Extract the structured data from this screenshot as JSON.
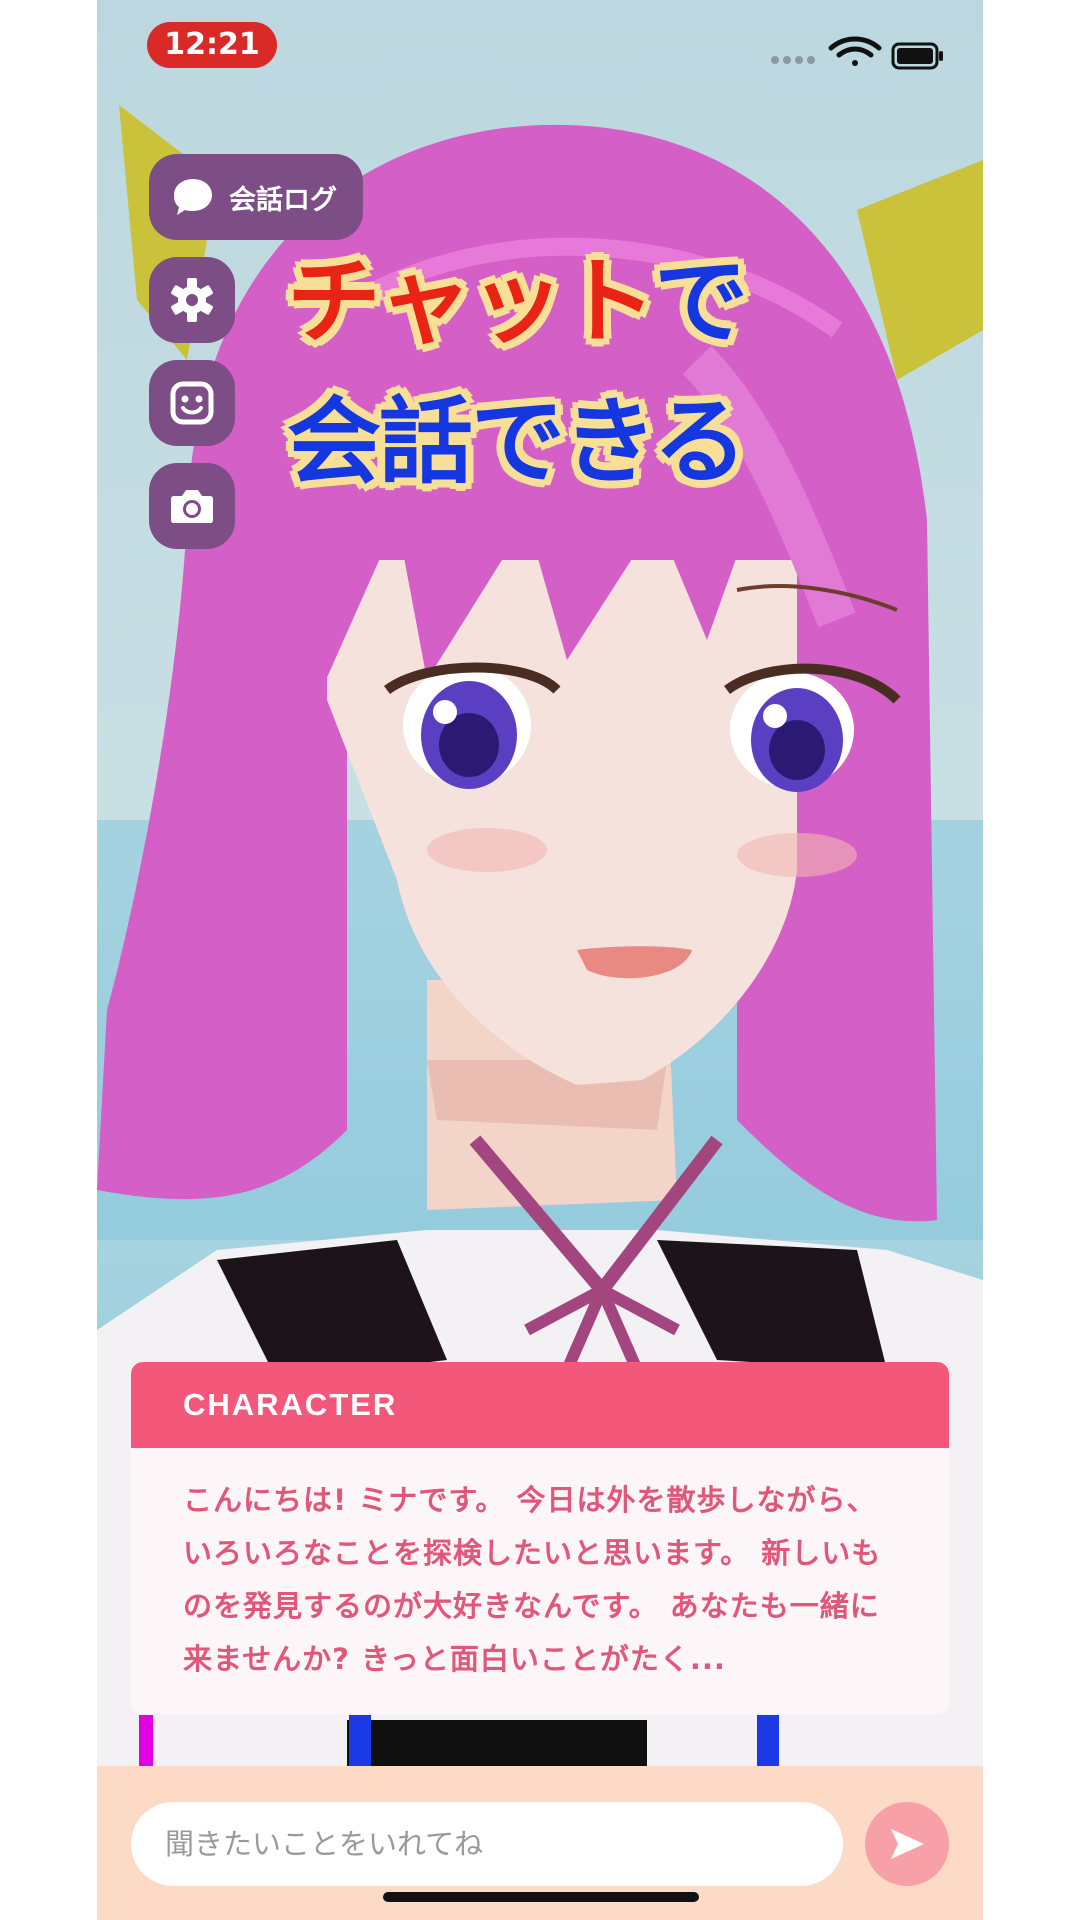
{
  "status_bar": {
    "time": "12:21",
    "icons": [
      "signal-icon",
      "wifi-icon",
      "battery-icon"
    ]
  },
  "side_menu": {
    "log_button_label": "会話ログ",
    "log_icon": "speech-bubble-icon",
    "buttons": [
      {
        "name": "settings-button",
        "icon": "gear-icon"
      },
      {
        "name": "expression-button",
        "icon": "smile-face-icon"
      },
      {
        "name": "camera-button",
        "icon": "camera-icon"
      }
    ]
  },
  "overlay_caption": {
    "line1_red": "チャット",
    "line1_blue": "で",
    "line2": "会話できる"
  },
  "character_card": {
    "header": "CHARACTER",
    "message": "こんにちは! ミナです。 今日は外を散歩しながら、いろいろなことを探検したいと思います。 新しいものを発見するのが大好きなんです。 あなたも一緒に来ませんか? きっと面白いことがたく..."
  },
  "input_bar": {
    "placeholder": "聞きたいことをいれてね",
    "value": "",
    "send_icon": "send-arrow-icon"
  },
  "colors": {
    "menu_button": "#7d4d86",
    "card_header": "#f3587a",
    "card_text": "#e0577a",
    "input_bar_bg": "#fddac6",
    "send_button": "#f8a0a8",
    "caption_red": "#ea2414",
    "caption_blue": "#1437e0",
    "caption_outline": "#f7df98",
    "hair": "#d45fc6"
  }
}
